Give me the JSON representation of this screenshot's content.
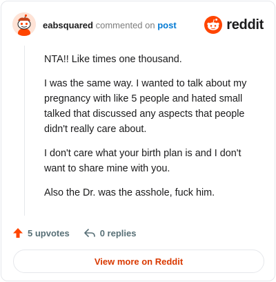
{
  "header": {
    "username": "eabsquared",
    "action_text": "commented on",
    "post_link": "post",
    "brand": "reddit"
  },
  "comment": {
    "paragraphs": [
      "NTA!! Like times one thousand.",
      "I was the same way. I wanted to talk about my pregnancy with like 5 people and hated small talked that discussed any aspects that people didn't really care about.",
      "I don't care what your birth plan is and I don't want to share mine with you.",
      "Also the Dr. was the asshole, fuck him."
    ]
  },
  "actions": {
    "upvotes": "5 upvotes",
    "replies": "0 replies"
  },
  "footer": {
    "view_more": "View more on Reddit"
  },
  "colors": {
    "accent": "#ff4500",
    "link": "#0079d3",
    "view_more": "#d93900"
  },
  "icons": {
    "avatar": "snoo-avatar",
    "brand": "reddit-logo-icon",
    "upvote": "upvote-arrow-icon",
    "reply": "reply-arrow-icon"
  }
}
